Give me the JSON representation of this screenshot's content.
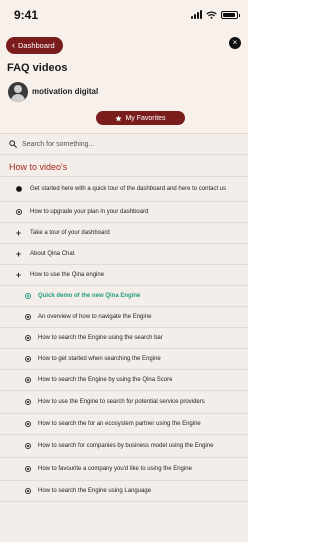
{
  "status_bar": {
    "time": "9:41"
  },
  "header": {
    "back_label": "Dashboard",
    "title": "FAQ videos",
    "profile_name": "motivation digital",
    "favorites_label": "My Favorites"
  },
  "search": {
    "placeholder": "Search for something..."
  },
  "section": {
    "title": "How to video's"
  },
  "items": [
    {
      "label": "Get started here with a quick tour of the dashboard and here to contact us",
      "icon": "circle-solid-icon",
      "level": 1
    },
    {
      "label": "How to upgrade your plan in your dashboard",
      "icon": "circle-dot-icon",
      "level": 1
    },
    {
      "label": "Take a tour of your dashboard",
      "icon": "plus-icon",
      "level": 1
    },
    {
      "label": "About Qina Chat",
      "icon": "plus-icon",
      "level": 1
    },
    {
      "label": "How to use the Qina engine",
      "icon": "plus-icon",
      "level": 1
    },
    {
      "label": "Quick demo of the new Qina Engine",
      "icon": "circle-dot-icon",
      "level": 2,
      "active": true
    },
    {
      "label": "An overview of how to navigate the Engine",
      "icon": "circle-dot-icon",
      "level": 2
    },
    {
      "label": "How to search the Engine using the search bar",
      "icon": "circle-dot-icon",
      "level": 2
    },
    {
      "label": "How to get started when searching the Engine",
      "icon": "circle-dot-icon",
      "level": 2
    },
    {
      "label": "How to search the Engine by using the Qina Score",
      "icon": "circle-dot-icon",
      "level": 2
    },
    {
      "label": "How to use the Engine to search for potential service providers",
      "icon": "circle-dot-icon",
      "level": 2
    },
    {
      "label": "How to search the for an ecosystem partner using the Engine",
      "icon": "circle-dot-icon",
      "level": 2
    },
    {
      "label": "How to search for companies by business model using the Engine",
      "icon": "circle-dot-icon",
      "level": 2
    },
    {
      "label": "How to favourite a company you'd like to using the Engine",
      "icon": "circle-dot-icon",
      "level": 2
    },
    {
      "label": "How to search the Engine using Language",
      "icon": "circle-dot-icon",
      "level": 2
    }
  ],
  "colors": {
    "brand": "#7a1c1c",
    "accent_green": "#1e9e7e",
    "section_red": "#a3291e",
    "background": "#f7f0eb"
  }
}
